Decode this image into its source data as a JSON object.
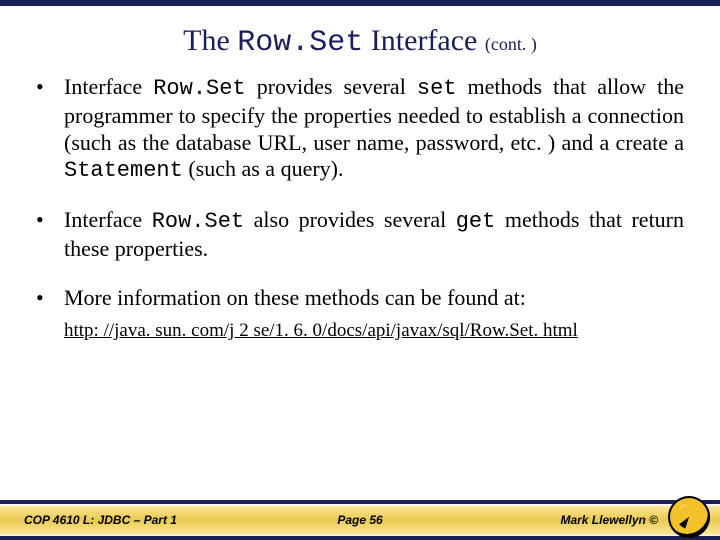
{
  "title": {
    "prefix": "The ",
    "code": "Row.Set",
    "suffix": " Interface ",
    "cont": "(cont. )"
  },
  "bullets": {
    "b1": {
      "t1": "Interface ",
      "c1": "Row.Set",
      "t2": " provides several ",
      "c2": "set",
      "t3": " methods that allow the programmer to specify the properties needed to establish a connection (such as the database URL, user name, password, etc. ) and a create a ",
      "c3": "Statement",
      "t4": " (such as a query)."
    },
    "b2": {
      "t1": "Interface ",
      "c1": "Row.Set",
      "t2": " also provides several ",
      "c2": "get",
      "t3": " methods that return these properties."
    },
    "b3": {
      "t1": "More information on these methods can be found at:"
    }
  },
  "link": "http: //java. sun. com/j 2 se/1. 6. 0/docs/api/javax/sql/Row.Set. html",
  "footer": {
    "left": "COP 4610 L: JDBC – Part 1",
    "center": "Page 56",
    "right": "Mark Llewellyn ©"
  }
}
